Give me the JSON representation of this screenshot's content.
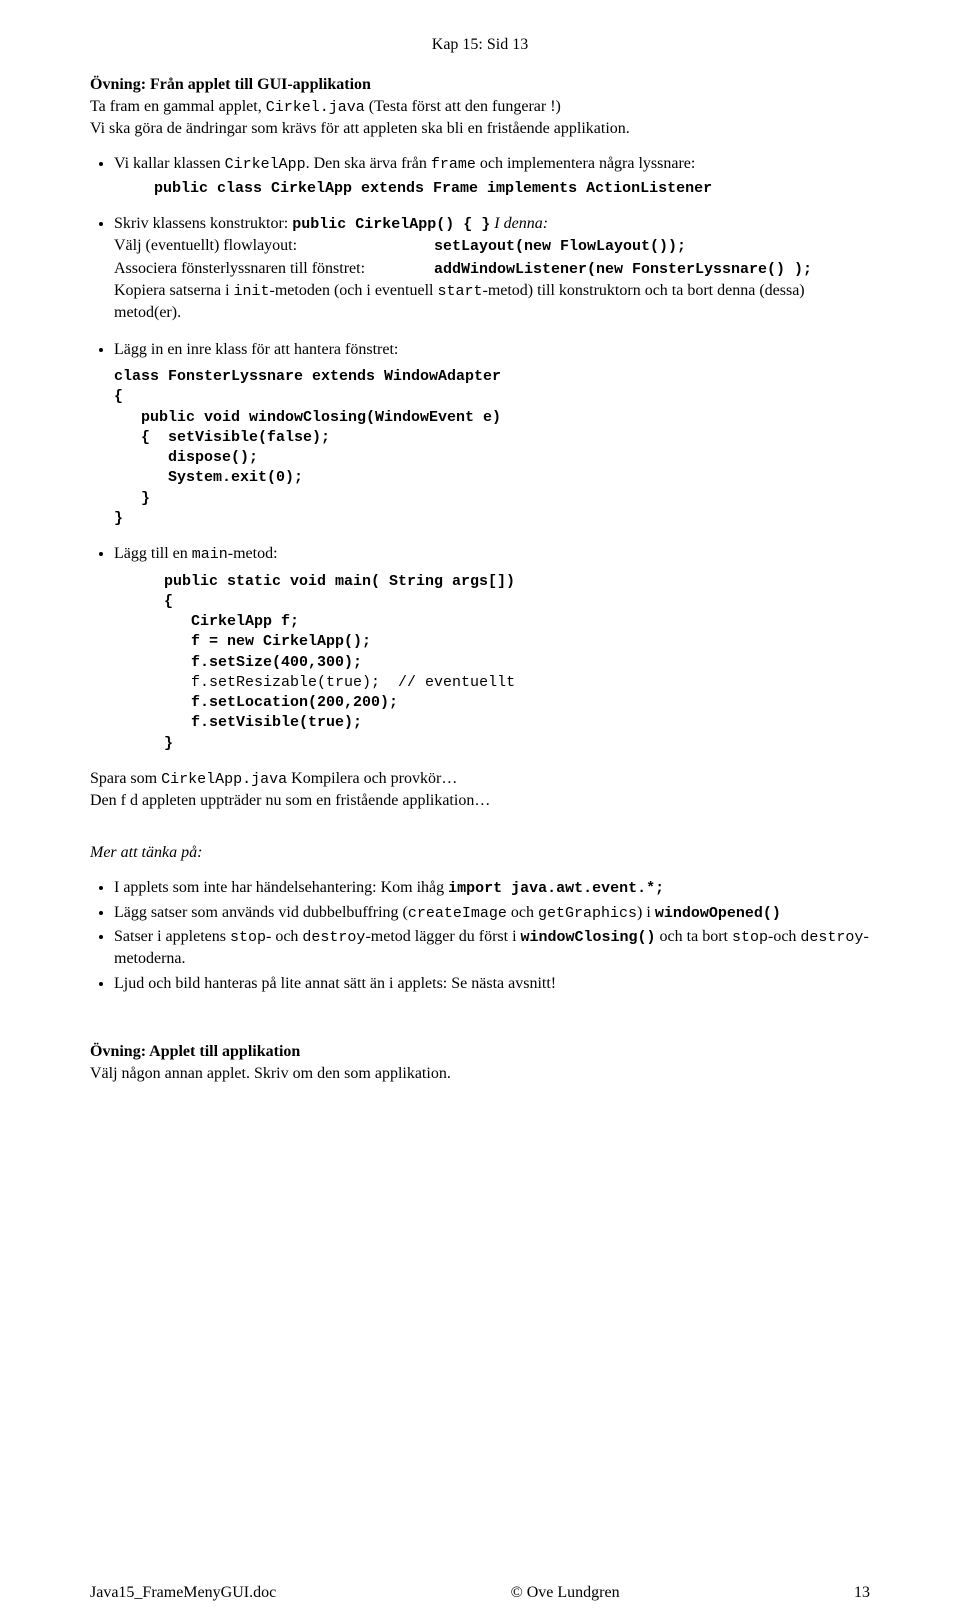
{
  "header": "Kap 15:  Sid 13",
  "exercise1": {
    "title": "Övning:  Från applet till GUI-applikation",
    "intro_part1": "Ta fram en gammal applet, ",
    "intro_code": "Cirkel.java",
    "intro_part2": "  (Testa först att den fungerar !)",
    "intro_line2": "Vi ska göra de ändringar som krävs för att appleten ska bli en fristående applikation."
  },
  "b1": {
    "part1": "Vi kallar klassen ",
    "code1": "CirkelApp",
    "part2": ". Den ska ärva från ",
    "code2": "frame",
    "part3": " och implementera några lyssnare:",
    "codeline": "public class CirkelApp extends Frame implements ActionListener"
  },
  "b2": {
    "part1": "Skriv klassens konstruktor:   ",
    "code1": "public CirkelApp() {   }",
    "tail1": "      ",
    "idenna": "I denna:",
    "l2_a": "Välj (eventuellt) flowlayout:",
    "l2_b": "setLayout(new FlowLayout());",
    "l3_a": "Associera fönsterlyssnaren till fönstret:",
    "l3_b": "addWindowListener(new FonsterLyssnare() );",
    "l4_a": "Kopiera satserna i ",
    "l4_b": "init",
    "l4_c": "-metoden (och i eventuell ",
    "l4_d": "start",
    "l4_e": "-metod) till konstruktorn och ta bort denna (dessa) metod(er)."
  },
  "b3": {
    "text": "Lägg in en inre klass för att hantera fönstret:",
    "code": "class FonsterLyssnare extends WindowAdapter\n{\n   public void windowClosing(WindowEvent e)\n   {  setVisible(false);\n      dispose();\n      System.exit(0);\n   }\n}"
  },
  "b4": {
    "part1": "Lägg till en ",
    "code1": "main",
    "part2": "-metod:",
    "line1": "public static void main( String args[])",
    "line2": "{",
    "line3": "   CirkelApp f;",
    "line4": "   f = new CirkelApp();",
    "line5": "   f.setSize(400,300);",
    "line6a": "   f.setResizable(true);",
    "line6b": "  // eventuellt",
    "line7": "   f.setLocation(200,200);",
    "line8": "   f.setVisible(true);",
    "line9": "}"
  },
  "spara": {
    "a": "Spara som ",
    "b": "CirkelApp.java",
    "c": "  Kompilera och provkör…",
    "d": "Den f d appleten uppträder nu som en fristående applikation…"
  },
  "mer": "Mer att tänka på:",
  "m1": {
    "a": "I applets som inte har händelsehantering:  Kom ihåg  ",
    "b": "import java.awt.event.*;"
  },
  "m2": {
    "a": "Lägg satser som används vid dubbelbuffring  (",
    "b": "createImage",
    "c": " och ",
    "d": "getGraphics",
    "e": ") i ",
    "f": "windowOpened()"
  },
  "m3": {
    "a": "Satser i appletens ",
    "b": "stop",
    "c": "- och ",
    "d": "destroy",
    "e": "-metod lägger du först i ",
    "f": "windowClosing()",
    "g": " och ta bort ",
    "h": "stop",
    "i": "-och ",
    "j": "destroy",
    "k": "-metoderna."
  },
  "m4": "Ljud och bild hanteras på lite annat sätt än i applets:   Se nästa avsnitt!",
  "exercise2": {
    "title": "Övning: Applet till applikation",
    "text": "Välj någon annan applet. Skriv om den som applikation."
  },
  "footer": {
    "left": "Java15_FrameMenyGUI.doc",
    "center": "© Ove Lundgren",
    "right": "13"
  }
}
